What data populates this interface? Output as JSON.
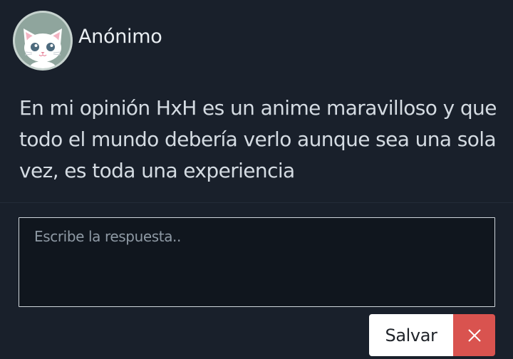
{
  "post": {
    "author": "Anónimo",
    "avatar_icon": "white-cat-avatar-icon",
    "body": "En mi opinión HxH es un anime maravilloso y que todo el mundo debería verlo aunque sea una sola vez, es toda una experiencia"
  },
  "reply": {
    "placeholder": "Escribe la respuesta..",
    "value": ""
  },
  "actions": {
    "save_label": "Salvar",
    "close_icon": "close-icon"
  },
  "colors": {
    "background": "#19202b",
    "input_background": "#10161e",
    "save_button": "#ffffff",
    "close_button": "#d9534f",
    "avatar_bg": "#8fa59d"
  }
}
